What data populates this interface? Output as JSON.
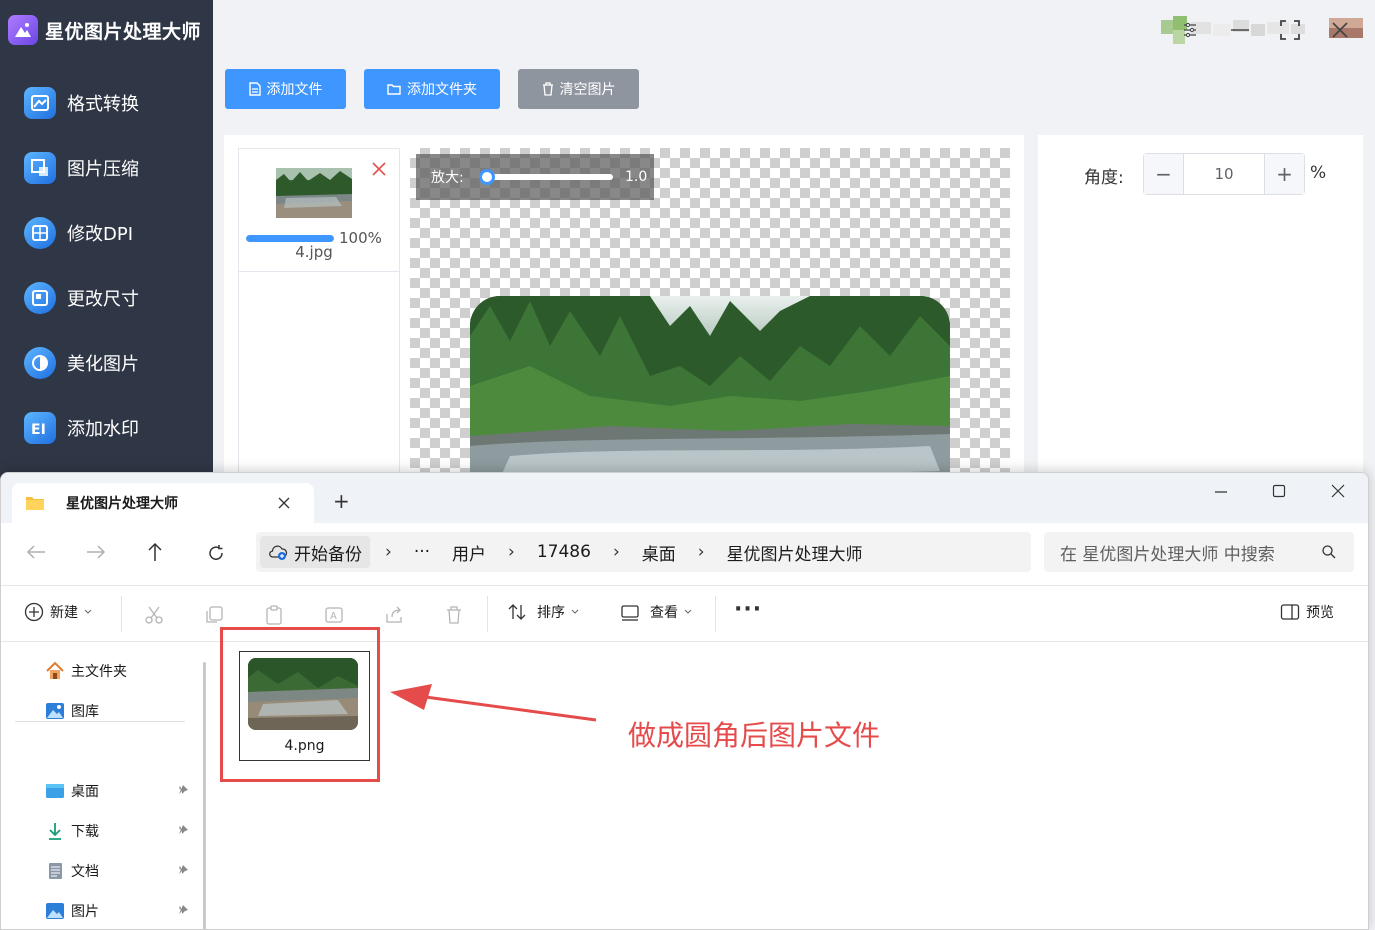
{
  "app": {
    "title": "星优图片处理大师",
    "nav": [
      {
        "label": "格式转换",
        "icon": "image-convert-icon"
      },
      {
        "label": "图片压缩",
        "icon": "image-compress-icon"
      },
      {
        "label": "修改DPI",
        "icon": "dpi-icon"
      },
      {
        "label": "更改尺寸",
        "icon": "resize-icon"
      },
      {
        "label": "美化图片",
        "icon": "beautify-icon"
      },
      {
        "label": "添加水印",
        "icon": "watermark-icon"
      }
    ],
    "toolbar": {
      "add_file": "添加文件",
      "add_folder": "添加文件夹",
      "clear_images": "清空图片"
    },
    "file_item": {
      "name": "4.jpg",
      "progress_text": "100%",
      "progress": 1.0
    },
    "zoom": {
      "label": "放大:",
      "value": "1.0",
      "level": 0.0
    },
    "angle": {
      "label": "角度:",
      "value": "10",
      "minus": "−",
      "plus": "+",
      "unit": "%"
    },
    "colors": {
      "sidebar": "#2f3746",
      "primary": "#4096ff",
      "gray": "#8f959e",
      "accent": "#e54b4b"
    }
  },
  "explorer": {
    "tab_title": "星优图片处理大师",
    "new_tab": "+",
    "breadcrumb": {
      "backup": "开始备份",
      "more": "···",
      "items": [
        "用户",
        "17486",
        "桌面",
        "星优图片处理大师"
      ],
      "sep": "›"
    },
    "search_placeholder": "在 星优图片处理大师 中搜索",
    "commands": {
      "new": "新建",
      "sort": "排序",
      "view": "查看",
      "more": "···",
      "preview": "预览"
    },
    "nav": {
      "home": "主文件夹",
      "gallery": "图库",
      "pinned": [
        "桌面",
        "下载",
        "文档",
        "图片"
      ]
    },
    "file": {
      "name": "4.png"
    },
    "annotation": "做成圆角后图片文件"
  }
}
